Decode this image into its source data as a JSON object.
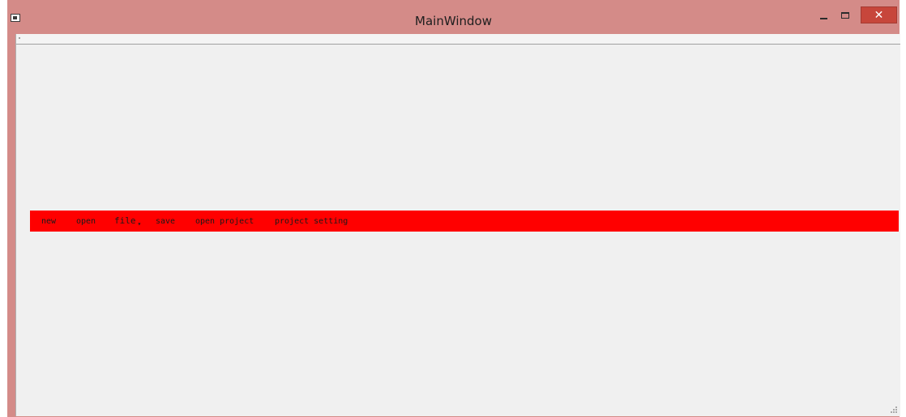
{
  "window": {
    "title": "MainWindow",
    "close_glyph": "✕",
    "controls": [
      "minimize-icon",
      "maximize-icon",
      "close-icon"
    ]
  },
  "toolbar": {
    "background": "#ff0000",
    "items": [
      {
        "label": "new"
      },
      {
        "label": "open"
      },
      {
        "label": "file",
        "has_dropdown": true
      },
      {
        "label": "save"
      },
      {
        "label": "open project"
      },
      {
        "label": "project setting"
      }
    ]
  },
  "colors": {
    "titlebar": "#d48b88",
    "client_bg": "#f0f0f0",
    "close_button": "#c7463b",
    "toolbar": "#ff0000"
  }
}
